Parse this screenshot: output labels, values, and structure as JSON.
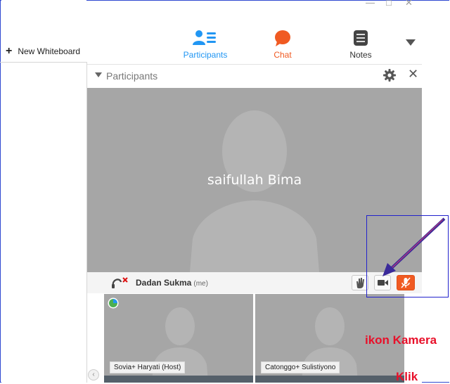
{
  "window_controls": {
    "minimize": "—",
    "maximize": "□",
    "close": "✕"
  },
  "left_panel": {
    "new_whiteboard_label": "New Whiteboard"
  },
  "tabs": [
    {
      "label": "Participants",
      "icon": "participants-icon",
      "color": "#2196f3"
    },
    {
      "label": "Chat",
      "icon": "chat-bubble-icon",
      "color": "#f05a22"
    },
    {
      "label": "Notes",
      "icon": "notes-icon",
      "color": "#333333"
    }
  ],
  "participants_panel": {
    "title": "Participants",
    "main_video": {
      "name": "saifullah Bima",
      "background": "#a6a6a6"
    },
    "self_row": {
      "name": "Dadan Sukma",
      "me_tag": "(me)"
    },
    "thumbnails": [
      {
        "name": "Sovia+ Haryati (Host)"
      },
      {
        "name": "Catonggo+ Sulistiyono"
      }
    ]
  },
  "annotation": {
    "label_1": "ikon Kamera",
    "label_2": "Klik",
    "text_color": "#e8102a",
    "box_color": "#2222cc",
    "arrow_color": "#3a2a9a"
  }
}
